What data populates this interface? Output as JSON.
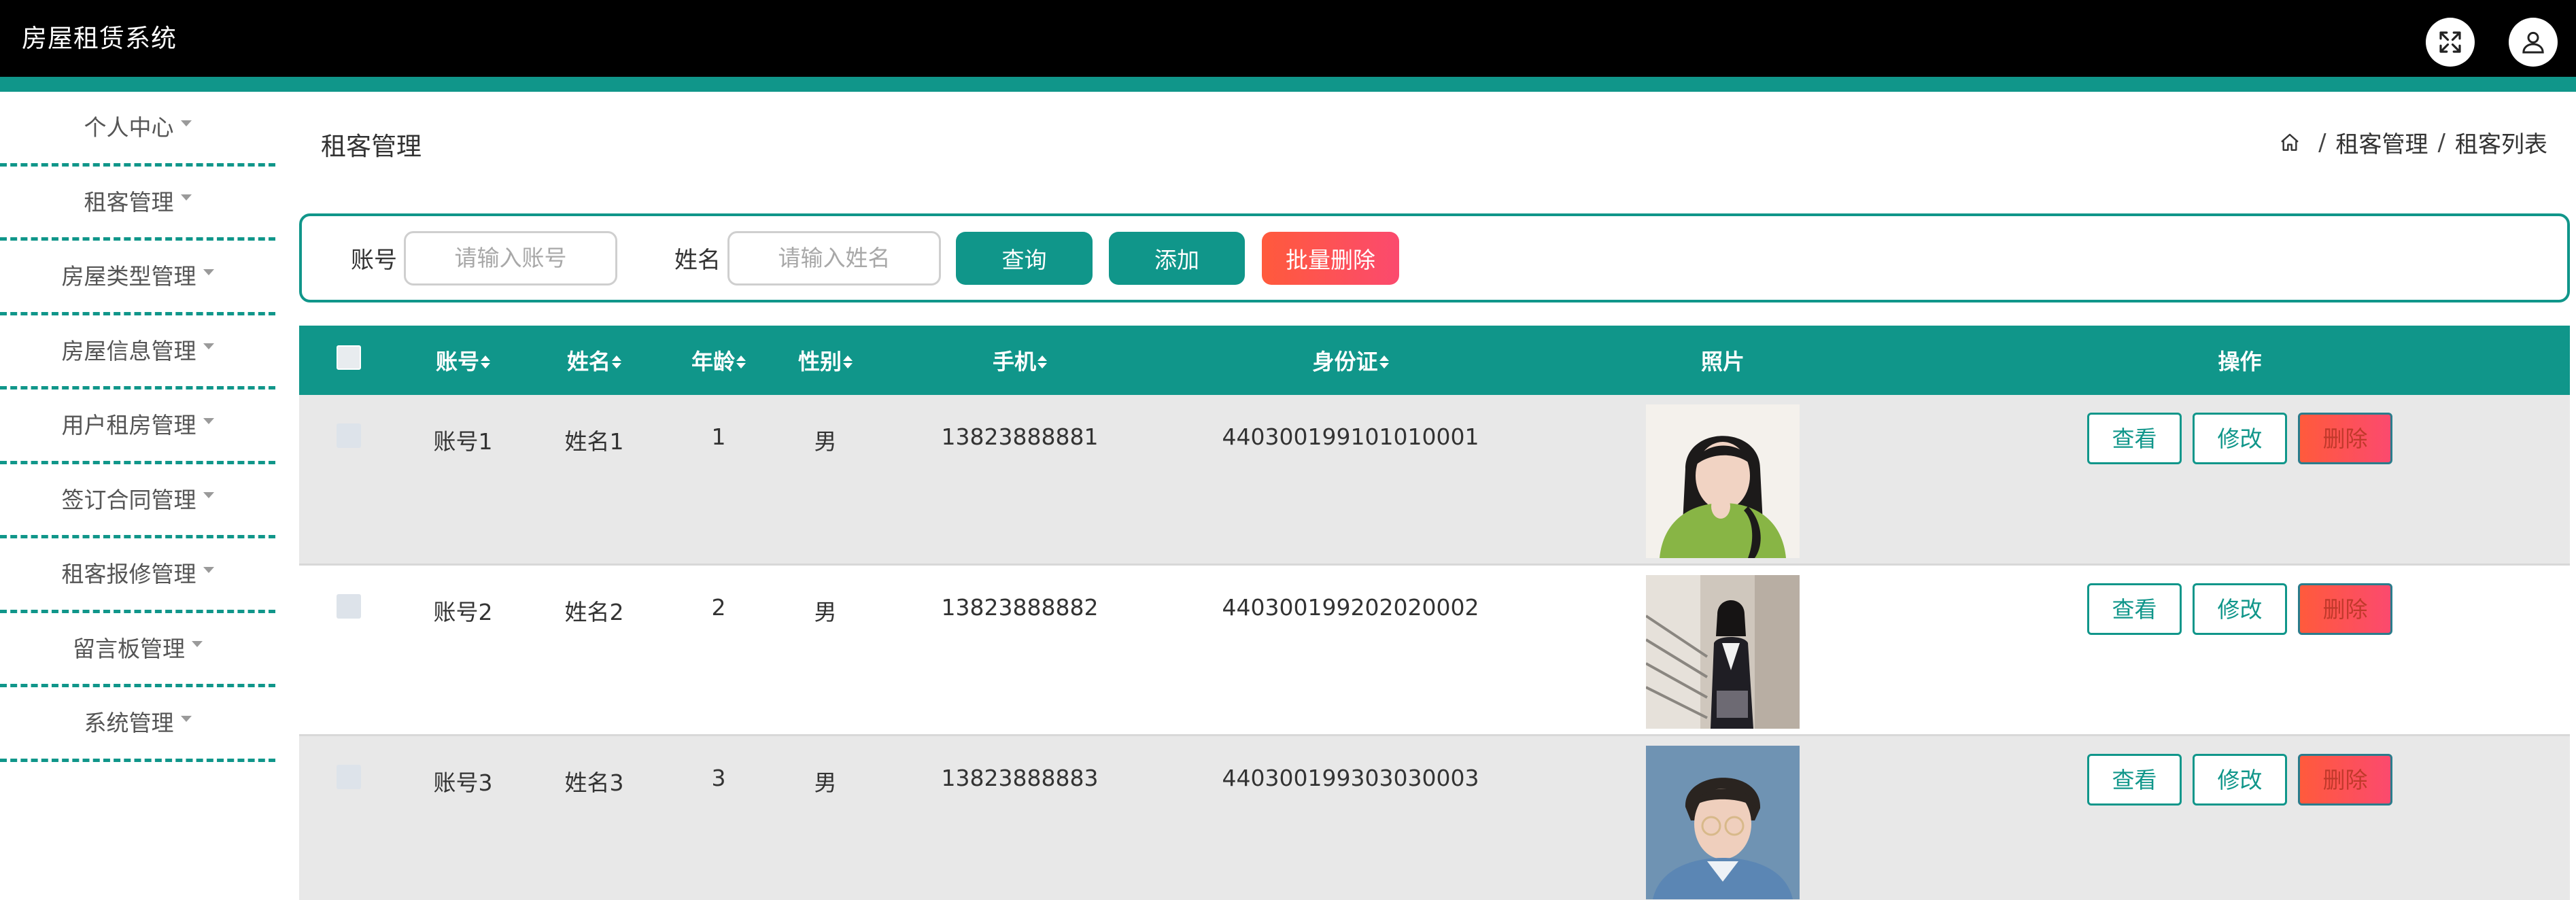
{
  "app": {
    "title": "房屋租赁系统"
  },
  "topbar": {
    "icons": [
      "fullscreen-icon",
      "user-icon"
    ]
  },
  "sidebar": {
    "items": [
      {
        "label": "个人中心"
      },
      {
        "label": "租客管理"
      },
      {
        "label": "房屋类型管理"
      },
      {
        "label": "房屋信息管理"
      },
      {
        "label": "用户租房管理"
      },
      {
        "label": "签订合同管理"
      },
      {
        "label": "租客报修管理"
      },
      {
        "label": "留言板管理"
      },
      {
        "label": "系统管理"
      }
    ]
  },
  "page": {
    "title": "租客管理",
    "breadcrumb": [
      "租客管理",
      "租客列表"
    ],
    "breadcrumb_sep": "/"
  },
  "search": {
    "account_label": "账号",
    "account_placeholder": "请输入账号",
    "name_label": "姓名",
    "name_placeholder": "请输入姓名",
    "query_button": "查询",
    "add_button": "添加",
    "batch_delete_button": "批量删除"
  },
  "table": {
    "headers": {
      "account": "账号",
      "name": "姓名",
      "age": "年龄",
      "gender": "性别",
      "phone": "手机",
      "id_card": "身份证",
      "photo": "照片",
      "ops": "操作"
    },
    "rows": [
      {
        "account": "账号1",
        "name": "姓名1",
        "age": "1",
        "gender": "男",
        "phone": "13823888881",
        "id_card": "440300199101010001"
      },
      {
        "account": "账号2",
        "name": "姓名2",
        "age": "2",
        "gender": "男",
        "phone": "13823888882",
        "id_card": "440300199202020002"
      },
      {
        "account": "账号3",
        "name": "姓名3",
        "age": "3",
        "gender": "男",
        "phone": "13823888883",
        "id_card": "440300199303030003"
      }
    ],
    "row_actions": {
      "view": "查看",
      "edit": "修改",
      "delete": "删除"
    }
  },
  "colors": {
    "brand": "#10968a",
    "topbar": "#000000",
    "danger_start": "#ff5a3c",
    "danger_end": "#fb4a6e",
    "row_alt": "#e8e8e8"
  }
}
